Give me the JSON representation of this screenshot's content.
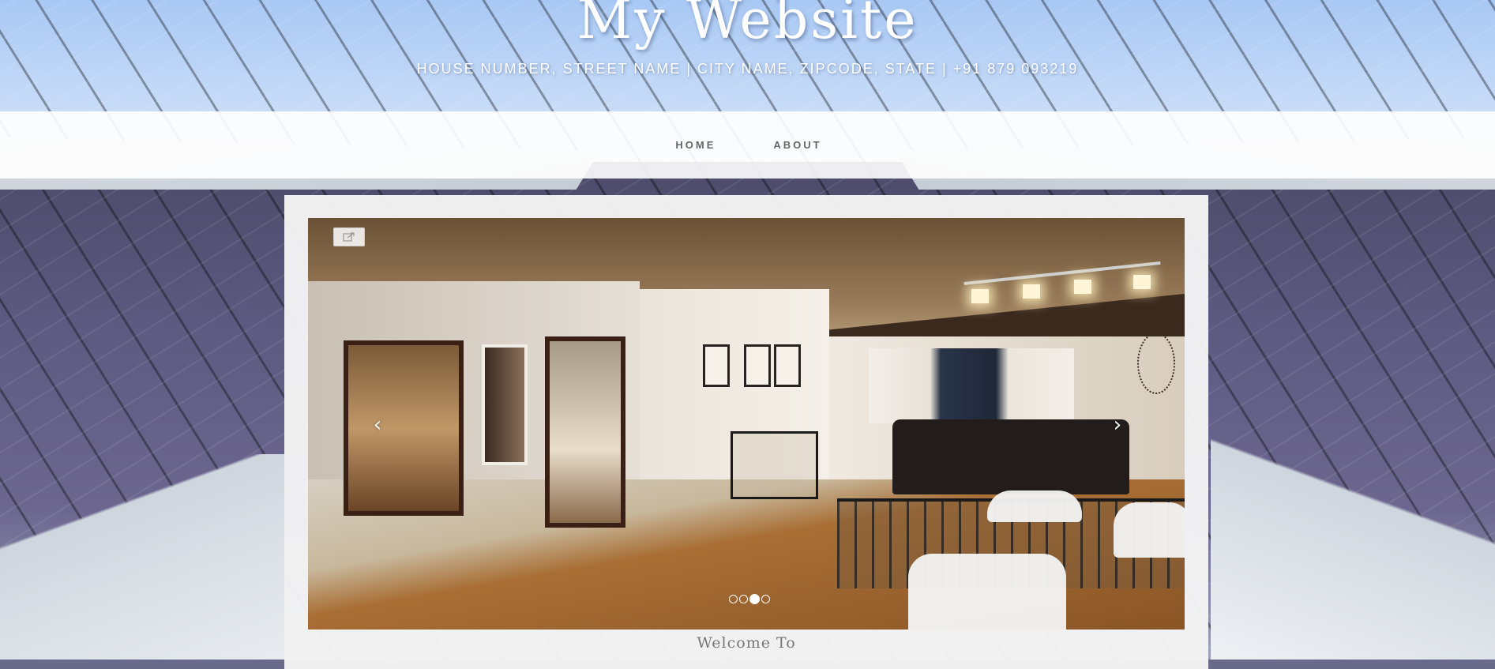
{
  "header": {
    "title": "My Website",
    "address": "HOUSE NUMBER, STREET NAME | CITY NAME, ZIPCODE, STATE | +91 879 093219"
  },
  "nav": {
    "items": [
      {
        "label": "HOME"
      },
      {
        "label": "ABOUT"
      }
    ]
  },
  "slider": {
    "prev_icon": "‹",
    "next_icon": "›",
    "dot_count": 4,
    "active_dot": 3,
    "edit_icon": "edit-external-icon"
  },
  "content": {
    "welcome_text": "Welcome To"
  },
  "colors": {
    "sky": "#a8c8f4",
    "nav_text": "#666666",
    "content_bg": "#f5f5f5"
  }
}
